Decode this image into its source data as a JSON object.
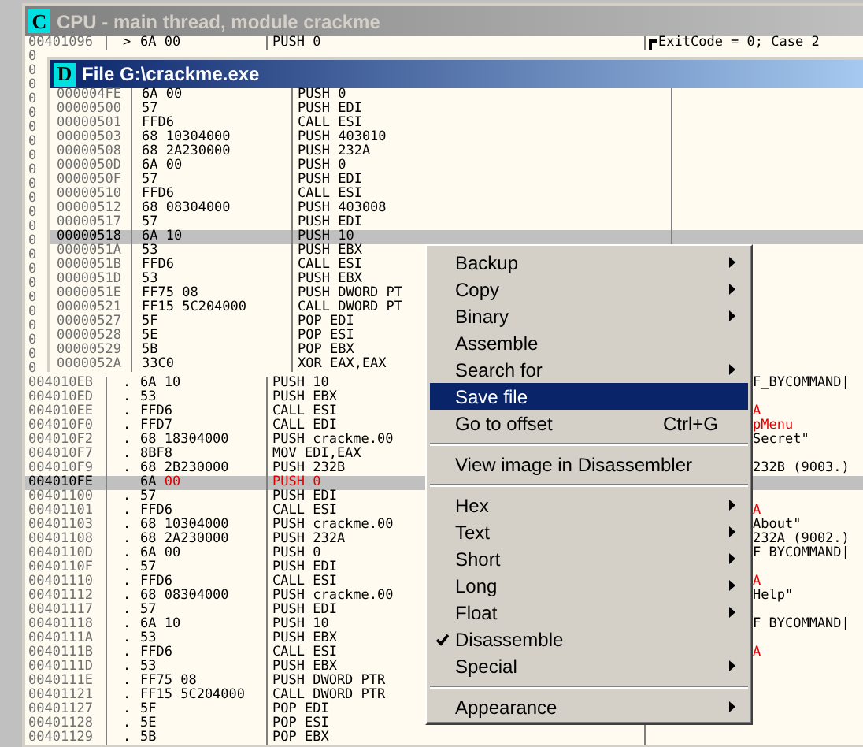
{
  "cpu": {
    "title": "CPU - main thread, module crackme",
    "icon_letter": "C",
    "top_row": {
      "address": "00401096",
      "marker": ">",
      "hex": "6A 00",
      "disasm": "PUSH 0",
      "comment": "ExitCode = 0; Case 2"
    },
    "covered_addresses": [
      "0",
      "0",
      "0",
      "0",
      "0",
      "0",
      "0",
      "0",
      "0",
      "0",
      "0",
      "0",
      "0",
      "0",
      "0",
      "0",
      "0",
      "0",
      "0",
      "0",
      "0",
      "0",
      "0"
    ],
    "rows": [
      {
        "address": "004010EB",
        "marker": ".",
        "hex": "6A 10",
        "disasm": "PUSH 10",
        "selected": false,
        "modified": false,
        "comment": {
          "text": "F_BYCOMMAND|",
          "api": false
        }
      },
      {
        "address": "004010ED",
        "marker": ".",
        "hex": "53",
        "disasm": "PUSH EBX",
        "selected": false,
        "modified": false
      },
      {
        "address": "004010EE",
        "marker": ".",
        "hex": "FFD6",
        "disasm": "CALL ESI",
        "selected": false,
        "modified": false,
        "comment": {
          "text": "A",
          "api": true
        }
      },
      {
        "address": "004010F0",
        "marker": ".",
        "hex": "FFD7",
        "disasm": "CALL EDI",
        "selected": false,
        "modified": false,
        "comment": {
          "text": "pMenu",
          "api": true
        }
      },
      {
        "address": "004010F2",
        "marker": ".",
        "hex": "68 18304000",
        "disasm": "PUSH crackme.00",
        "selected": false,
        "modified": false,
        "comment": {
          "text": "Secret\"",
          "api": false
        }
      },
      {
        "address": "004010F7",
        "marker": ".",
        "hex": "8BF8",
        "disasm": "MOV EDI,EAX",
        "selected": false,
        "modified": false
      },
      {
        "address": "004010F9",
        "marker": ".",
        "hex": "68 2B230000",
        "disasm": "PUSH 232B",
        "selected": false,
        "modified": false,
        "comment": {
          "text": "232B (9003.)",
          "api": false
        }
      },
      {
        "address": "004010FE",
        "hex": "6A",
        "patched_bytes": "00",
        "disasm": "PUSH 0",
        "selected": true,
        "modified": true
      },
      {
        "address": "00401100",
        "marker": ".",
        "hex": "57",
        "disasm": "PUSH EDI",
        "selected": false,
        "modified": false
      },
      {
        "address": "00401101",
        "marker": ".",
        "hex": "FFD6",
        "disasm": "CALL ESI",
        "selected": false,
        "modified": false,
        "comment": {
          "text": "A",
          "api": true
        }
      },
      {
        "address": "00401103",
        "marker": ".",
        "hex": "68 10304000",
        "disasm": "PUSH crackme.00",
        "selected": false,
        "modified": false,
        "comment": {
          "text": "About\"",
          "api": false
        }
      },
      {
        "address": "00401108",
        "marker": ".",
        "hex": "68 2A230000",
        "disasm": "PUSH 232A",
        "selected": false,
        "modified": false,
        "comment": {
          "text": "232A (9002.)",
          "api": false
        }
      },
      {
        "address": "0040110D",
        "marker": ".",
        "hex": "6A 00",
        "disasm": "PUSH 0",
        "selected": false,
        "modified": false,
        "comment": {
          "text": "F_BYCOMMAND|",
          "api": false
        }
      },
      {
        "address": "0040110F",
        "marker": ".",
        "hex": "57",
        "disasm": "PUSH EDI",
        "selected": false,
        "modified": false
      },
      {
        "address": "00401110",
        "marker": ".",
        "hex": "FFD6",
        "disasm": "CALL ESI",
        "selected": false,
        "modified": false,
        "comment": {
          "text": "A",
          "api": true
        }
      },
      {
        "address": "00401112",
        "marker": ".",
        "hex": "68 08304000",
        "disasm": "PUSH crackme.00",
        "selected": false,
        "modified": false,
        "comment": {
          "text": "Help\"",
          "api": false
        }
      },
      {
        "address": "00401117",
        "marker": ".",
        "hex": "57",
        "disasm": "PUSH EDI",
        "selected": false,
        "modified": false
      },
      {
        "address": "00401118",
        "marker": ".",
        "hex": "6A 10",
        "disasm": "PUSH 10",
        "selected": false,
        "modified": false,
        "comment": {
          "text": "F_BYCOMMAND|",
          "api": false
        }
      },
      {
        "address": "0040111A",
        "marker": ".",
        "hex": "53",
        "disasm": "PUSH EBX",
        "selected": false,
        "modified": false
      },
      {
        "address": "0040111B",
        "marker": ".",
        "hex": "FFD6",
        "disasm": "CALL ESI",
        "selected": false,
        "modified": false,
        "comment": {
          "text": "A",
          "api": true
        }
      },
      {
        "address": "0040111D",
        "marker": ".",
        "hex": "53",
        "disasm": "PUSH EBX",
        "selected": false,
        "modified": false
      },
      {
        "address": "0040111E",
        "marker": ".",
        "hex": "FF75 08",
        "disasm": "PUSH DWORD PTR",
        "selected": false,
        "modified": false
      },
      {
        "address": "00401121",
        "marker": ".",
        "hex": "FF15 5C204000",
        "disasm": "CALL DWORD PTR",
        "selected": false,
        "modified": false
      },
      {
        "address": "00401127",
        "marker": ".",
        "hex": "5F",
        "disasm": "POP EDI",
        "selected": false,
        "modified": false
      },
      {
        "address": "00401128",
        "marker": ".",
        "hex": "5E",
        "disasm": "POP ESI",
        "selected": false,
        "modified": false
      },
      {
        "address": "00401129",
        "marker": ".",
        "hex": "5B",
        "disasm": "POP EBX",
        "selected": false,
        "modified": false
      }
    ]
  },
  "file_window": {
    "title": "File G:\\crackme.exe",
    "icon_letter": "D",
    "rows": [
      {
        "address": "000004FE",
        "hex": "6A 00",
        "disasm": "PUSH 0",
        "selected": false
      },
      {
        "address": "00000500",
        "hex": "57",
        "disasm": "PUSH EDI",
        "selected": false
      },
      {
        "address": "00000501",
        "hex": "FFD6",
        "disasm": "CALL ESI",
        "selected": false
      },
      {
        "address": "00000503",
        "hex": "68 10304000",
        "disasm": "PUSH 403010",
        "selected": false
      },
      {
        "address": "00000508",
        "hex": "68 2A230000",
        "disasm": "PUSH 232A",
        "selected": false
      },
      {
        "address": "0000050D",
        "hex": "6A 00",
        "disasm": "PUSH 0",
        "selected": false
      },
      {
        "address": "0000050F",
        "hex": "57",
        "disasm": "PUSH EDI",
        "selected": false
      },
      {
        "address": "00000510",
        "hex": "FFD6",
        "disasm": "CALL ESI",
        "selected": false
      },
      {
        "address": "00000512",
        "hex": "68 08304000",
        "disasm": "PUSH 403008",
        "selected": false
      },
      {
        "address": "00000517",
        "hex": "57",
        "disasm": "PUSH EDI",
        "selected": false
      },
      {
        "address": "00000518",
        "hex": "6A 10",
        "disasm": "PUSH 10",
        "selected": true
      },
      {
        "address": "0000051A",
        "hex": "53",
        "disasm": "PUSH EBX",
        "selected": false
      },
      {
        "address": "0000051B",
        "hex": "FFD6",
        "disasm": "CALL ESI",
        "selected": false
      },
      {
        "address": "0000051D",
        "hex": "53",
        "disasm": "PUSH EBX",
        "selected": false
      },
      {
        "address": "0000051E",
        "hex": "FF75 08",
        "disasm": "PUSH DWORD PT",
        "selected": false
      },
      {
        "address": "00000521",
        "hex": "FF15 5C204000",
        "disasm": "CALL DWORD PT",
        "selected": false
      },
      {
        "address": "00000527",
        "hex": "5F",
        "disasm": "POP EDI",
        "selected": false
      },
      {
        "address": "00000528",
        "hex": "5E",
        "disasm": "POP ESI",
        "selected": false
      },
      {
        "address": "00000529",
        "hex": "5B",
        "disasm": "POP EBX",
        "selected": false
      },
      {
        "address": "0000052A",
        "hex": "33C0",
        "disasm": "XOR EAX,EAX",
        "selected": false
      }
    ]
  },
  "context_menu": {
    "items": [
      {
        "kind": "item",
        "label": "Backup",
        "submenu": true,
        "checked": false,
        "selected": false
      },
      {
        "kind": "item",
        "label": "Copy",
        "submenu": true,
        "checked": false,
        "selected": false
      },
      {
        "kind": "item",
        "label": "Binary",
        "submenu": true,
        "checked": false,
        "selected": false
      },
      {
        "kind": "item",
        "label": "Assemble",
        "submenu": false,
        "checked": false,
        "selected": false
      },
      {
        "kind": "item",
        "label": "Search for",
        "submenu": true,
        "checked": false,
        "selected": false
      },
      {
        "kind": "item",
        "label": "Save file",
        "submenu": false,
        "checked": false,
        "selected": true
      },
      {
        "kind": "item",
        "label": "Go to offset",
        "shortcut": "Ctrl+G",
        "submenu": false,
        "checked": false,
        "selected": false
      },
      {
        "kind": "separator"
      },
      {
        "kind": "item",
        "label": "View image in Disassembler",
        "submenu": false,
        "checked": false,
        "selected": false
      },
      {
        "kind": "separator"
      },
      {
        "kind": "item",
        "label": "Hex",
        "submenu": true,
        "checked": false,
        "selected": false
      },
      {
        "kind": "item",
        "label": "Text",
        "submenu": true,
        "checked": false,
        "selected": false
      },
      {
        "kind": "item",
        "label": "Short",
        "submenu": true,
        "checked": false,
        "selected": false
      },
      {
        "kind": "item",
        "label": "Long",
        "submenu": true,
        "checked": false,
        "selected": false
      },
      {
        "kind": "item",
        "label": "Float",
        "submenu": true,
        "checked": false,
        "selected": false
      },
      {
        "kind": "item",
        "label": "Disassemble",
        "submenu": false,
        "checked": true,
        "selected": false
      },
      {
        "kind": "item",
        "label": "Special",
        "submenu": true,
        "checked": false,
        "selected": false
      },
      {
        "kind": "separator"
      },
      {
        "kind": "item",
        "label": "Appearance",
        "submenu": true,
        "checked": false,
        "selected": false
      }
    ]
  }
}
